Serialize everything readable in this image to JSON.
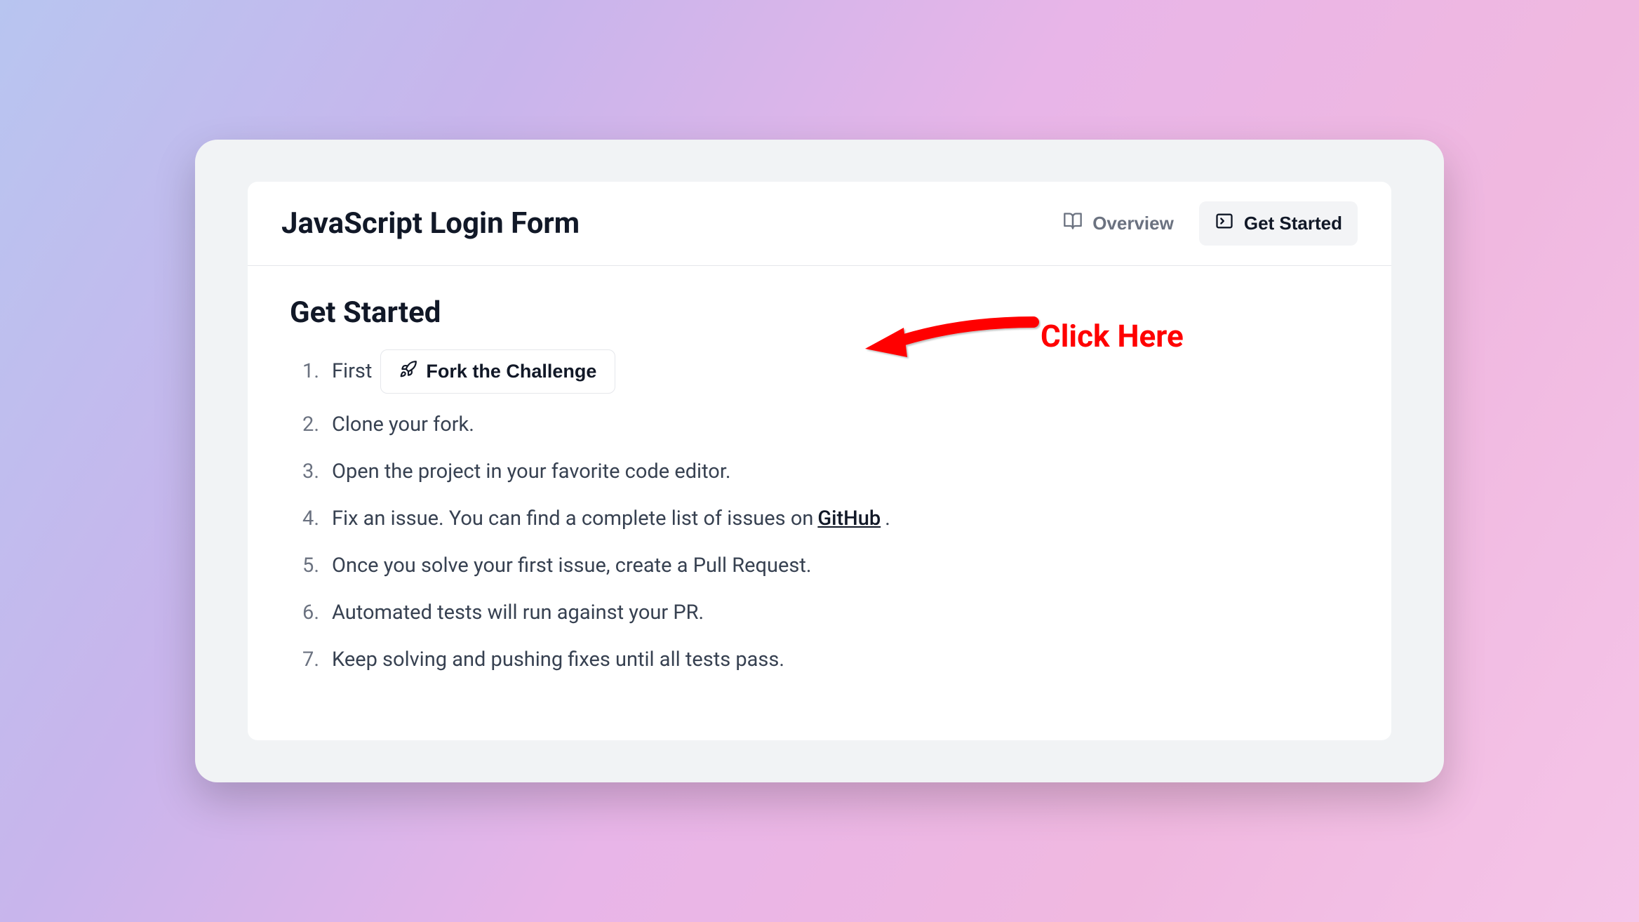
{
  "header": {
    "title": "JavaScript Login Form",
    "tabs": {
      "overview": "Overview",
      "getStarted": "Get Started"
    }
  },
  "section": {
    "title": "Get Started"
  },
  "steps": {
    "s1_prefix": "First",
    "s1_button": "Fork the Challenge",
    "s2": "Clone your fork.",
    "s3": "Open the project in your favorite code editor.",
    "s4_prefix": "Fix an issue. You can find a complete list of issues on ",
    "s4_link": "GitHub",
    "s4_suffix": ".",
    "s5": "Once you solve your first issue, create a Pull Request.",
    "s6": "Automated tests will run against your PR.",
    "s7": "Keep solving and pushing fixes until all tests pass."
  },
  "callout": {
    "text": "Click Here"
  }
}
